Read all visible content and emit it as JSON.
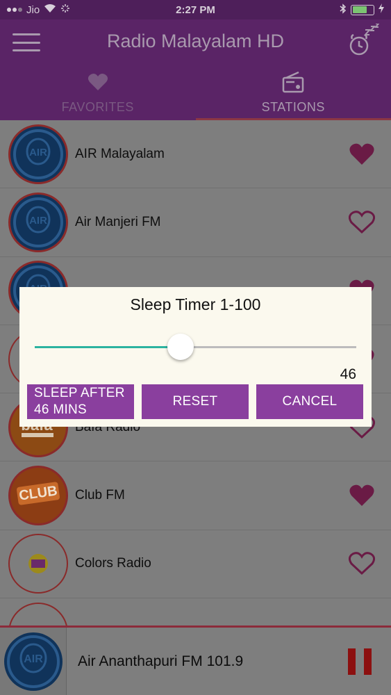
{
  "status_bar": {
    "carrier": "Jio",
    "time": "2:27 PM",
    "battery_level": 0.7
  },
  "header": {
    "title": "Radio Malayalam HD"
  },
  "tabs": [
    {
      "label": "FAVORITES",
      "icon": "heart-icon",
      "active": false
    },
    {
      "label": "STATIONS",
      "icon": "radio-icon",
      "active": true
    }
  ],
  "stations": [
    {
      "name": "AIR Malayalam",
      "logo": "air-logo",
      "favorite": true
    },
    {
      "name": "Air Manjeri FM",
      "logo": "air-logo",
      "favorite": false
    },
    {
      "name": "",
      "logo": "air-logo",
      "favorite": true
    },
    {
      "name": "",
      "logo": "plain-logo",
      "favorite": true
    },
    {
      "name": "Bafa Radio",
      "logo": "bafa-logo",
      "favorite": false
    },
    {
      "name": "Club FM",
      "logo": "club-fm-logo",
      "favorite": true
    },
    {
      "name": "Colors Radio",
      "logo": "colors-radio-logo",
      "favorite": false
    }
  ],
  "logos": {
    "air_text": "AIR",
    "bafa_text": "bafa",
    "club_text": "CLUB"
  },
  "player": {
    "now_playing": "Air Ananthapuri FM 101.9"
  },
  "dialog": {
    "title": "Sleep Timer 1-100",
    "slider_min": 1,
    "slider_max": 100,
    "slider_value": 46,
    "value_label": "46",
    "buttons": {
      "sleep_line1": "SLEEP AFTER",
      "sleep_line2": "46 MINS",
      "reset": "RESET",
      "cancel": "CANCEL"
    }
  },
  "colors": {
    "header_bg": "#5a2466",
    "accent_button": "#8a3f9e",
    "slider_fill": "#2bb3a0",
    "heart": "#6a1b45",
    "overlay_list": "#7e7e7e"
  }
}
